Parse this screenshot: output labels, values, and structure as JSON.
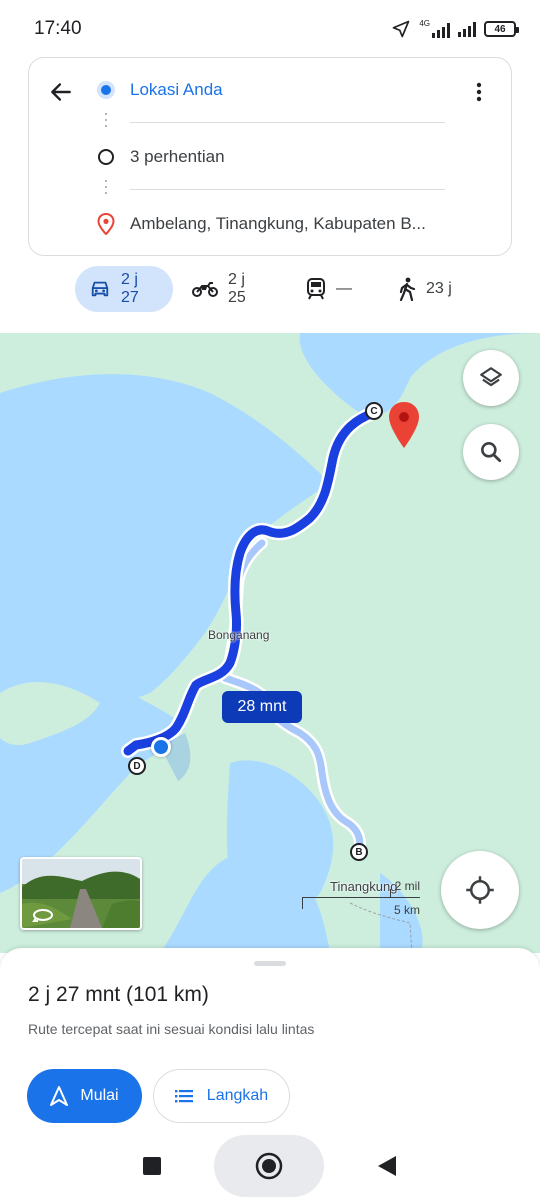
{
  "status_bar": {
    "time": "17:40",
    "network_label": "4G",
    "battery": "46",
    "icons": [
      "location-arrow-icon",
      "signal-4g-icon",
      "signal-icon",
      "battery-icon"
    ]
  },
  "directions": {
    "origin": "Lokasi Anda",
    "stops": "3 perhentian",
    "destination": "Ambelang, Tinangkung, Kabupaten B...",
    "icons": [
      "back-arrow-icon",
      "more-vert-icon",
      "origin-dot-icon",
      "stops-ring-icon",
      "destination-pin-icon"
    ]
  },
  "modes": [
    {
      "name": "car",
      "value": "2 j 27",
      "active": true
    },
    {
      "name": "motorcycle",
      "value": "2 j 25",
      "active": false
    },
    {
      "name": "transit",
      "value": "—",
      "active": false
    },
    {
      "name": "walk",
      "value": "23 j",
      "active": false
    }
  ],
  "map": {
    "eta_chip": "28 mnt",
    "place_labels": {
      "bonganang": "Bonganang",
      "tinangkung": "Tinangkung"
    },
    "scale": {
      "imperial": "2 mil",
      "metric": "5 km"
    },
    "stops": {
      "b": "B",
      "c": "C",
      "d": "D"
    },
    "colors": {
      "water": "#aadaff",
      "land": "#cdeedd",
      "route": "#1a40e0",
      "route_alt": "#a8c7fa",
      "pin": "#ea4335"
    },
    "icons": [
      "layers-icon",
      "search-icon",
      "my-location-icon",
      "street-view-icon",
      "destination-pin-icon"
    ]
  },
  "sheet": {
    "route_time": "2 j 27 mnt (101 km)",
    "note": "Rute tercepat saat ini sesuai kondisi lalu lintas",
    "start_label": "Mulai",
    "steps_label": "Langkah"
  },
  "navbar": {
    "icons": [
      "recents-square-icon",
      "home-circle-icon",
      "back-triangle-icon"
    ]
  }
}
